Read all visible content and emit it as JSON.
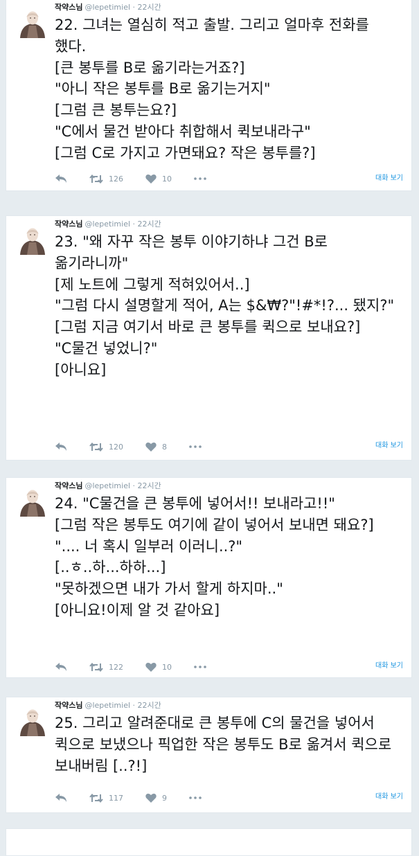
{
  "tweets": [
    {
      "name": "작약스님",
      "meta": "@lepetimiel · 22시간",
      "text": "22. 그녀는 열심히 적고 출발. 그리고 얼마후 전화를 했다.\n[큰 봉투를 B로 옮기라는거죠?]\n\"아니 작은 봉투를 B로 옮기는거지\"\n[그럼 큰 봉투는요?]\n\"C에서 물건 받아다 취합해서 퀵보내라구\"\n[그럼 C로 가지고 가면돼요? 작은 봉투를?]",
      "retweets": "126",
      "likes": "10",
      "conversation": "대화 보기"
    },
    {
      "name": "작약스님",
      "meta": "@lepetimiel · 22시간",
      "text": "23. \"왜 자꾸 작은 봉투 이야기하냐 그건 B로 옮기라니까\"\n[제 노트에 그렇게 적혀있어서..]\n\"그럼 다시 설명할게 적어, A는 $&₩?\"!#*!?... 됐지?\"\n[그럼 지금 여기서 바로 큰 봉투를 퀵으로 보내요?]\n\"C물건 넣었니?\"\n[아니요]",
      "retweets": "120",
      "likes": "8",
      "conversation": "대화 보기"
    },
    {
      "name": "작약스님",
      "meta": "@lepetimiel · 22시간",
      "text": "24. \"C물건을 큰 봉투에 넣어서!! 보내라고!!\"\n[그럼 작은 봉투도 여기에 같이 넣어서 보내면 돼요?]\n\".... 너 혹시 일부러 이러니..?\"\n[..ㅎ..하...하하...]\n\"못하겠으면 내가 가서 할게 하지마..\"\n[아니요!이제 알 것 같아요]",
      "retweets": "122",
      "likes": "10",
      "conversation": "대화 보기"
    },
    {
      "name": "작약스님",
      "meta": "@lepetimiel · 22시간",
      "text": "25. 그리고 알려준대로 큰 봉투에 C의 물건을 넣어서 퀵으로 보냈으나 픽업한 작은 봉투도 B로 옮겨서 퀵으로 보내버림 [..?!]",
      "retweets": "117",
      "likes": "9",
      "conversation": "대화 보기"
    }
  ],
  "icons": {
    "reply": "reply-icon",
    "retweet": "retweet-icon",
    "like": "heart-icon",
    "more": "more-dots-icon"
  },
  "colors": {
    "background": "#e6ecf0",
    "text": "#14171a",
    "muted": "#8899a6",
    "link": "#1b95e0"
  }
}
